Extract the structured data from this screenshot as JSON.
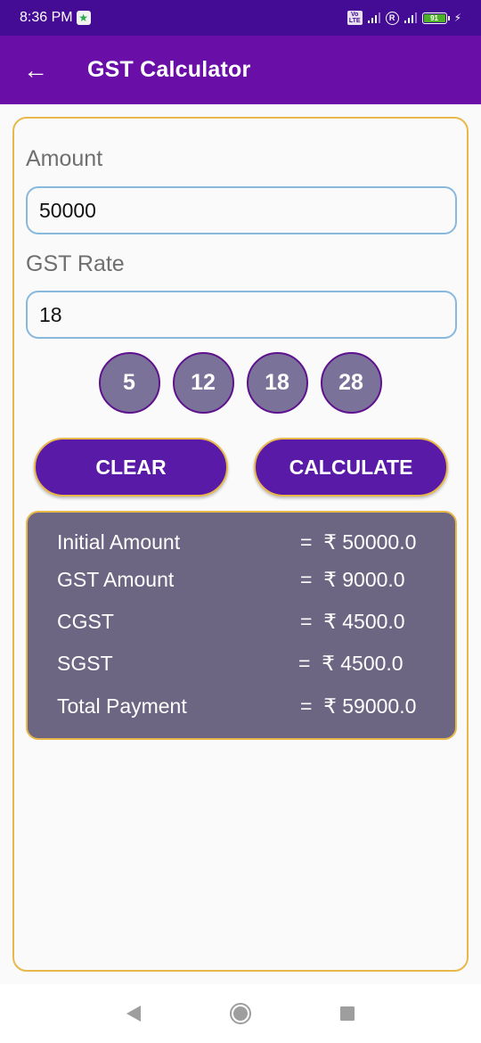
{
  "status_bar": {
    "time": "8:36 PM",
    "volte": "Vo LTE",
    "roaming": "R",
    "battery": "91",
    "charging": "⚡"
  },
  "app_bar": {
    "back_icon": "←",
    "title": "GST Calculator"
  },
  "form": {
    "amount_label": "Amount",
    "amount_value": "50000",
    "rate_label": "GST Rate",
    "rate_value": "18"
  },
  "rate_chips": [
    "5",
    "12",
    "18",
    "28"
  ],
  "buttons": {
    "clear": "CLEAR",
    "calculate": "CALCULATE"
  },
  "results": [
    {
      "label": "Initial Amount",
      "value": "=  ₹ 50000.0"
    },
    {
      "label": "GST Amount",
      "value": "=  ₹ 9000.0"
    },
    {
      "label": "CGST",
      "value": "=  ₹ 4500.0"
    },
    {
      "label": "SGST",
      "value": "=  ₹ 4500.0"
    },
    {
      "label": "Total Payment",
      "value": "=  ₹ 59000.0"
    }
  ],
  "colors": {
    "status_bar": "#440c94",
    "app_bar": "#6a0ea8",
    "accent_border": "#e8b84a",
    "button": "#5a1aa8",
    "chip": "#7a7299",
    "result_panel": "#6c6683",
    "input_border": "#88b8dc"
  }
}
